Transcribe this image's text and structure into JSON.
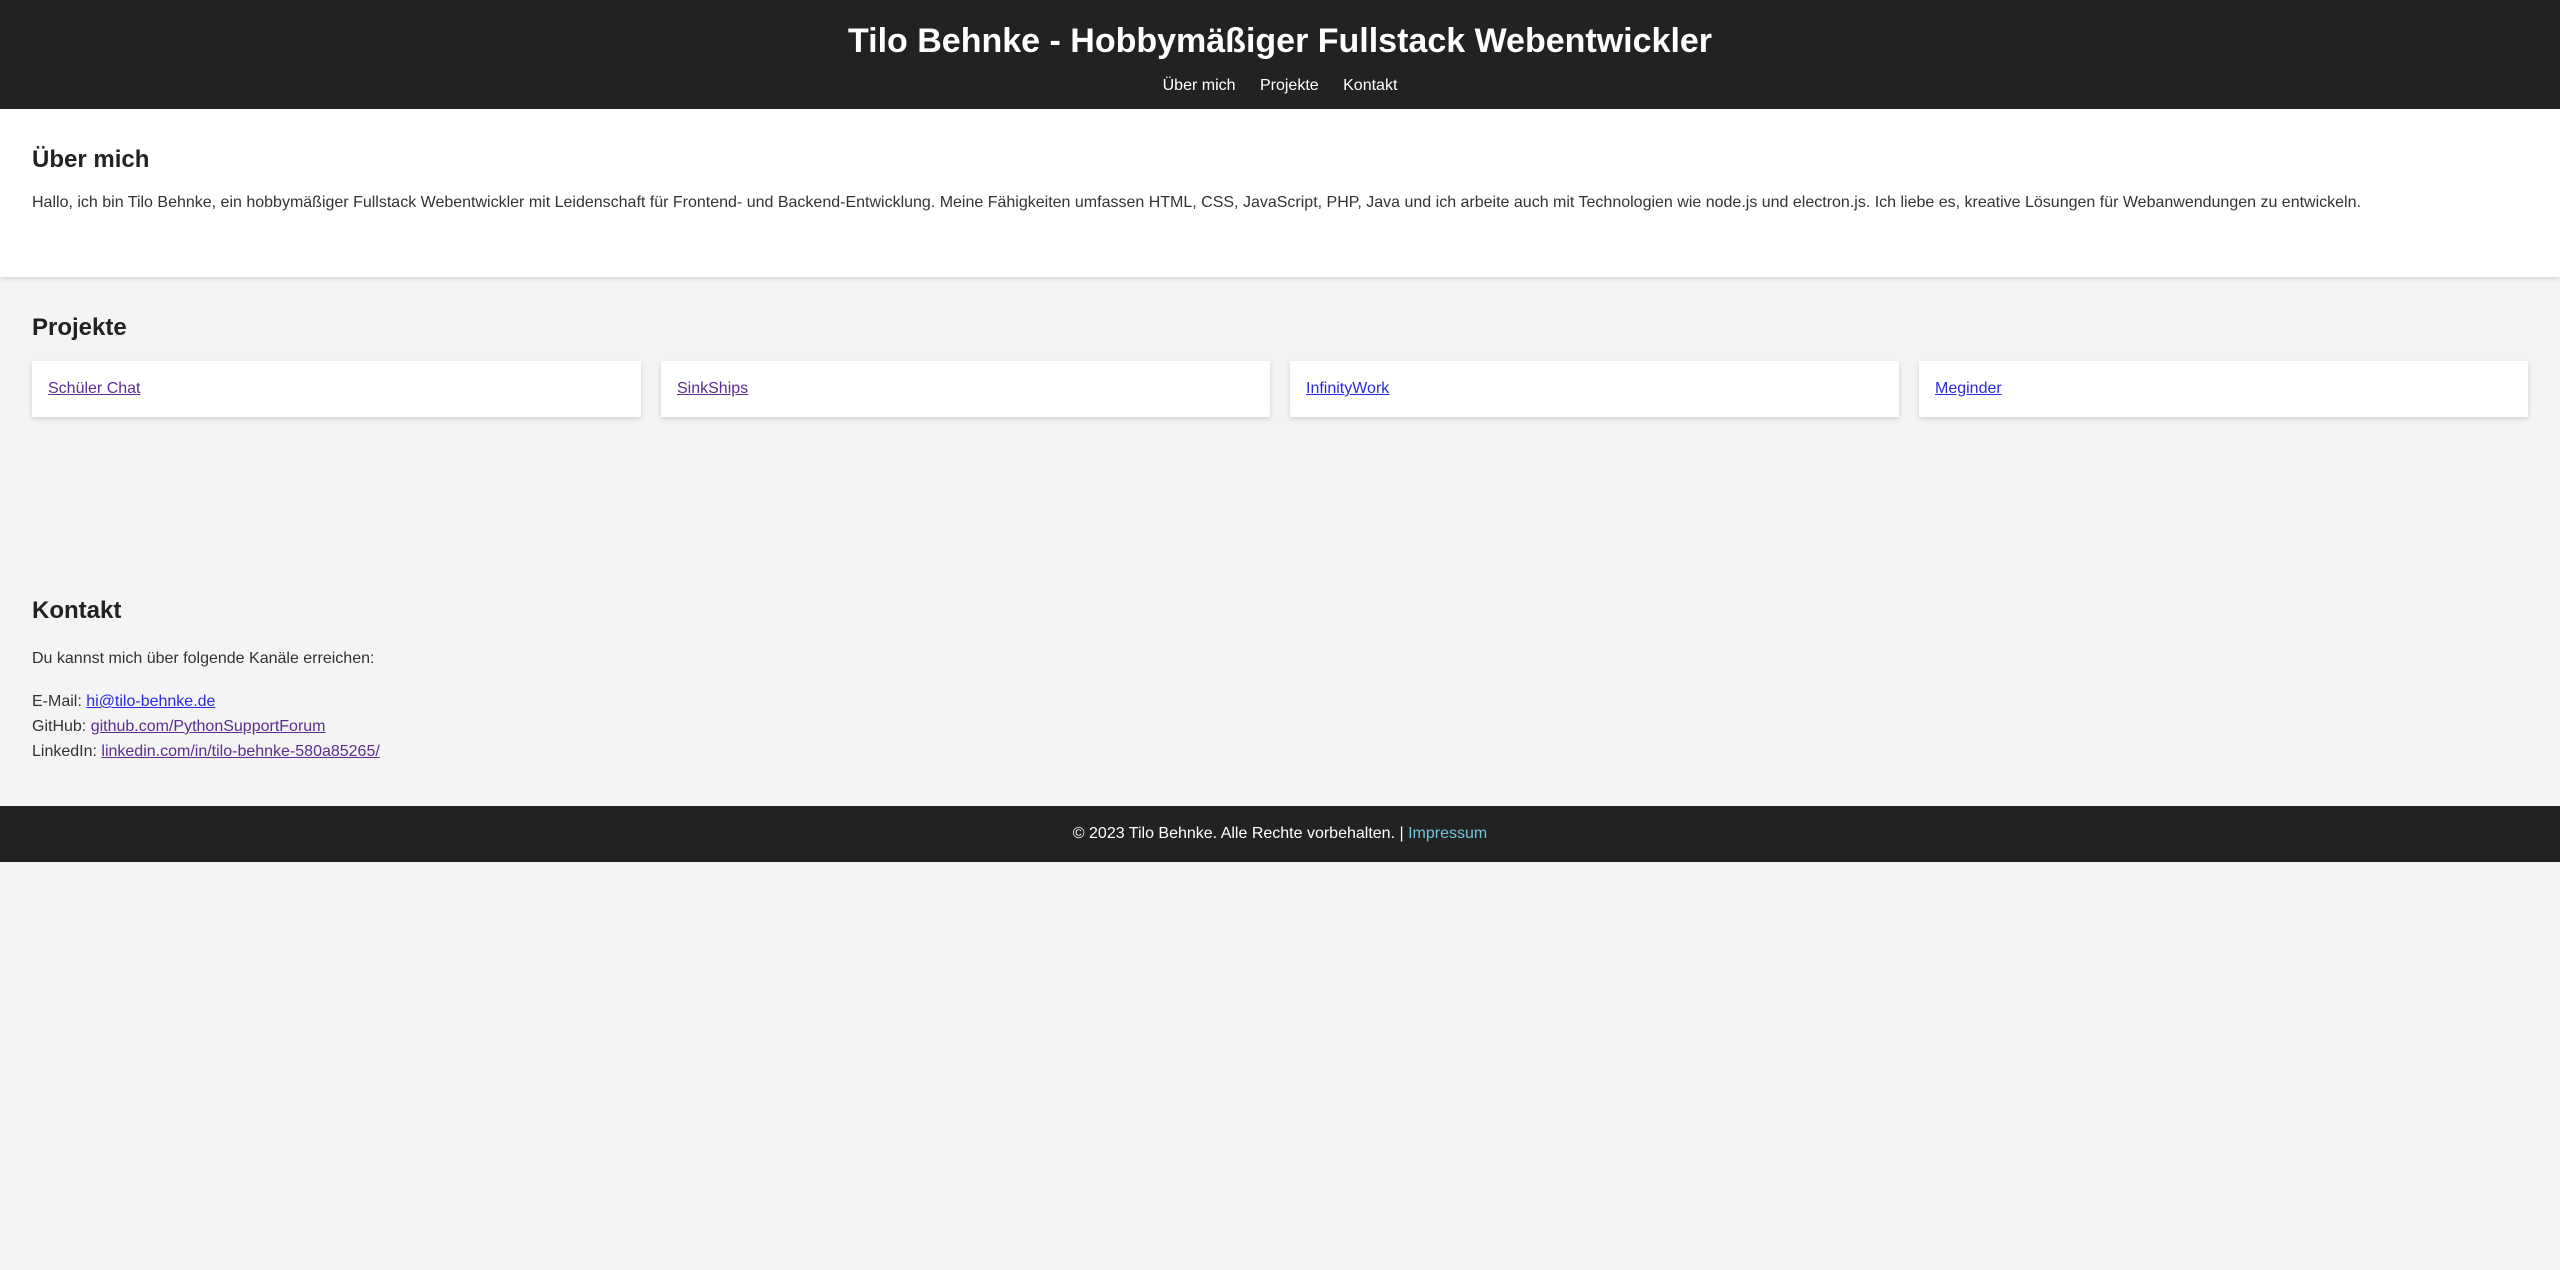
{
  "header": {
    "title": "Tilo Behnke - Hobbymäßiger Fullstack Webentwickler",
    "nav": [
      "Über mich",
      "Projekte",
      "Kontakt"
    ]
  },
  "about": {
    "heading": "Über mich",
    "text": "Hallo, ich bin Tilo Behnke, ein hobbymäßiger Fullstack Webentwickler mit Leidenschaft für Frontend- und Backend-Entwicklung. Meine Fähigkeiten umfassen HTML, CSS, JavaScript, PHP, Java und ich arbeite auch mit Technologien wie node.js und electron.js. Ich liebe es, kreative Lösungen für Webanwendungen zu entwickeln."
  },
  "projects": {
    "heading": "Projekte",
    "items": [
      "Schüler Chat",
      "SinkShips",
      "InfinityWork",
      "Meginder"
    ]
  },
  "contact": {
    "heading": "Kontakt",
    "intro": "Du kannst mich über folgende Kanäle erreichen:",
    "email_label": "E-Mail:",
    "email_value": "hi@tilo-behnke.de",
    "github_label": "GitHub:",
    "github_value": "github.com/PythonSupportForum",
    "linkedin_label": "LinkedIn:",
    "linkedin_value": "linkedin.com/in/tilo-behnke-580a85265/"
  },
  "footer": {
    "copyright": "© 2023 Tilo Behnke. Alle Rechte vorbehalten. |",
    "impressum": "Impressum"
  },
  "colors": {
    "header_bg": "#222222",
    "page_bg": "#f4f4f4",
    "visited_link": "#5b2d8e",
    "link": "#2a2ae0",
    "footer_link": "#6fc3df"
  }
}
